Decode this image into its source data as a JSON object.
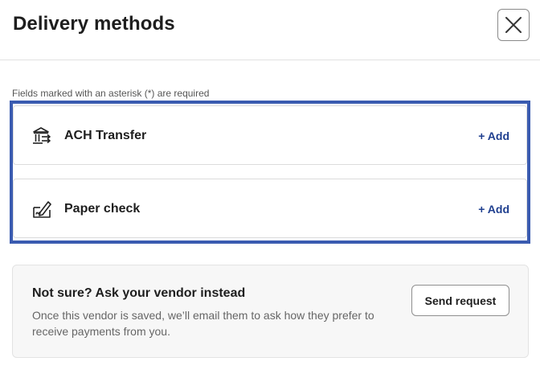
{
  "header": {
    "title": "Delivery methods",
    "close_icon": "close-icon"
  },
  "form": {
    "required_hint": "Fields marked with an asterisk (*) are required"
  },
  "methods": [
    {
      "label": "ACH Transfer",
      "icon": "bank-transfer-icon",
      "action": "+ Add"
    },
    {
      "label": "Paper check",
      "icon": "check-sign-icon",
      "action": "+ Add"
    }
  ],
  "vendor_request": {
    "title": "Not sure? Ask your vendor instead",
    "description": "Once this vendor is saved, we’ll email them to ask how they prefer to receive payments from you.",
    "button_label": "Send request"
  },
  "colors": {
    "accent": "#1f3f8f",
    "highlight_border": "#3a5bb0",
    "panel_background": "#f7f7f7"
  }
}
